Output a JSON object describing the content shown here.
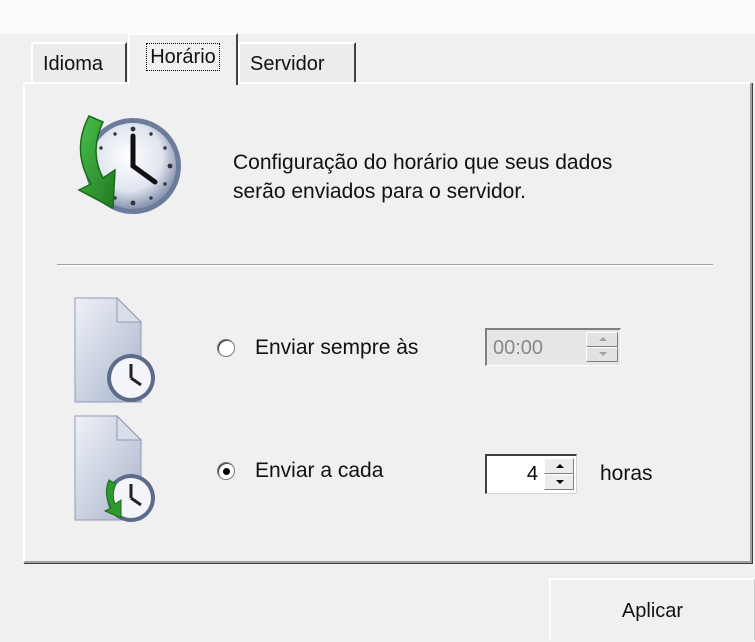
{
  "tabs": [
    {
      "label": "Idioma",
      "active": false
    },
    {
      "label": "Horário",
      "active": true
    },
    {
      "label": "Servidor",
      "active": false
    }
  ],
  "header": {
    "icon": "clock-download-icon",
    "description_line1": "Configuração do horário que seus dados",
    "description_line2": "serão enviados para o servidor."
  },
  "options": {
    "fixed_time": {
      "icon": "document-clock-icon",
      "label": "Enviar sempre às",
      "selected": false,
      "value": "00:00",
      "enabled": false
    },
    "interval": {
      "icon": "document-clock-refresh-icon",
      "label": "Enviar a cada",
      "selected": true,
      "value": "4",
      "unit": "horas"
    }
  },
  "buttons": {
    "apply_label": "Aplicar"
  },
  "colors": {
    "background": "#f0f0f0",
    "arrow_green": "#2e9a2e",
    "clock_blue": "#8a9ab8"
  }
}
